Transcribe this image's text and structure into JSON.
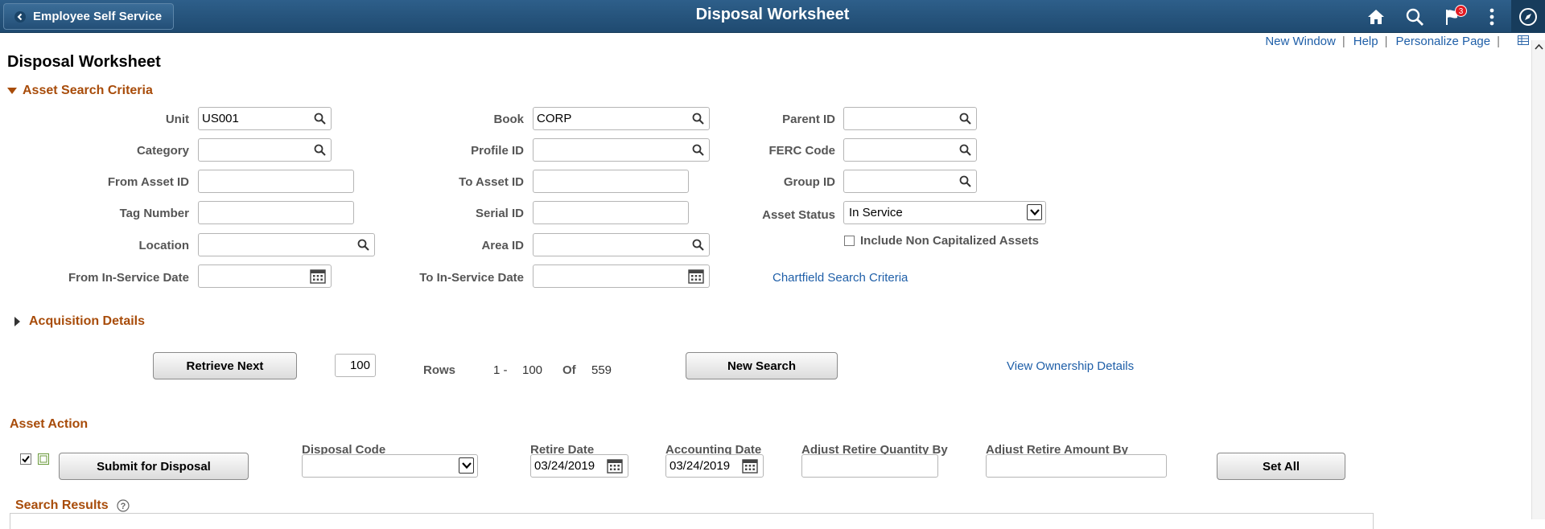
{
  "header": {
    "back_label": "Employee Self Service",
    "title": "Disposal Worksheet",
    "notification_count": "3"
  },
  "links": {
    "new_window": "New Window",
    "help": "Help",
    "personalize": "Personalize Page",
    "sep": "|"
  },
  "page_title": "Disposal Worksheet",
  "criteria": {
    "section_label": "Asset Search Criteria",
    "unit_label": "Unit",
    "unit_value": "US001",
    "book_label": "Book",
    "book_value": "CORP",
    "parent_id_label": "Parent ID",
    "category_label": "Category",
    "profile_id_label": "Profile ID",
    "ferc_code_label": "FERC Code",
    "from_asset_id_label": "From Asset ID",
    "to_asset_id_label": "To Asset ID",
    "group_id_label": "Group ID",
    "tag_number_label": "Tag Number",
    "serial_id_label": "Serial ID",
    "asset_status_label": "Asset Status",
    "asset_status_value": "In Service",
    "include_non_cap_label": "Include Non Capitalized Assets",
    "location_label": "Location",
    "area_id_label": "Area ID",
    "from_in_service_label": "From In-Service Date",
    "to_in_service_label": "To In-Service Date",
    "chartfield_link": "Chartfield Search Criteria"
  },
  "acquisition": {
    "section_label": "Acquisition Details"
  },
  "paging": {
    "retrieve_next": "Retrieve Next",
    "rows_value": "100",
    "rows_label": "Rows",
    "range_start": "1 -",
    "range_end": "100",
    "of_label": "Of",
    "total": "559",
    "new_search": "New Search",
    "ownership_link": "View Ownership Details"
  },
  "asset_action": {
    "section_label": "Asset Action",
    "submit_button": "Submit for Disposal",
    "disposal_code_label": "Disposal Code",
    "retire_date_label": "Retire Date",
    "retire_date_value": "03/24/2019",
    "accounting_date_label": "Accounting Date",
    "accounting_date_value": "03/24/2019",
    "adj_qty_label": "Adjust Retire Quantity By",
    "adj_amt_label": "Adjust Retire Amount By",
    "set_all": "Set All"
  },
  "results": {
    "section_label": "Search Results"
  }
}
